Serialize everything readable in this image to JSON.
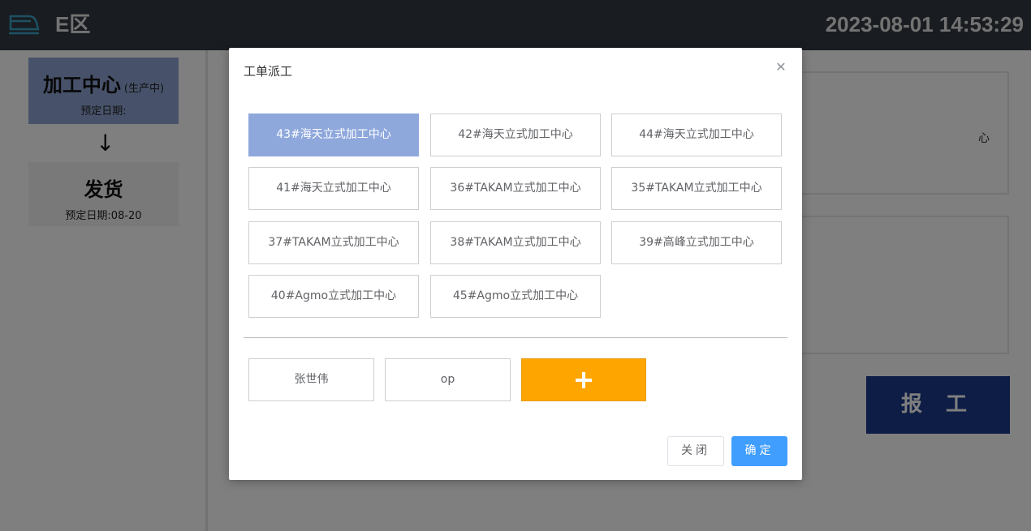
{
  "header": {
    "area_title": "E区",
    "clock": "2023-08-01 14:53:29",
    "logo_icon": "train-icon"
  },
  "sidebar": {
    "steps": [
      {
        "name": "加工中心",
        "status": "(生产中)",
        "date_label": "预定日期:"
      },
      {
        "name": "发货",
        "date_label": "预定日期:08-20"
      }
    ],
    "arrow": "↓"
  },
  "main": {
    "panel_fragment": "心",
    "report_button": "报 工"
  },
  "dialog": {
    "title": "工单派工",
    "close_icon": "close-icon",
    "machines": [
      {
        "label": "43#海天立式加工中心",
        "selected": true
      },
      {
        "label": "42#海天立式加工中心",
        "selected": false
      },
      {
        "label": "44#海天立式加工中心",
        "selected": false
      },
      {
        "label": "41#海天立式加工中心",
        "selected": false
      },
      {
        "label": "36#TAKAM立式加工中心",
        "selected": false
      },
      {
        "label": "35#TAKAM立式加工中心",
        "selected": false
      },
      {
        "label": "37#TAKAM立式加工中心",
        "selected": false
      },
      {
        "label": "38#TAKAM立式加工中心",
        "selected": false
      },
      {
        "label": "39#高峰立式加工中心",
        "selected": false
      },
      {
        "label": "40#Agmo立式加工中心",
        "selected": false
      },
      {
        "label": "45#Agmo立式加工中心",
        "selected": false
      }
    ],
    "workers": [
      "张世伟",
      "op"
    ],
    "add_icon": "plus-icon",
    "buttons": {
      "cancel": "关闭",
      "confirm": "确定"
    }
  },
  "colors": {
    "header_bg": "#333840",
    "selected_machine": "#8fa8dc",
    "add_button": "#ffa500",
    "confirm_button": "#409eff",
    "report_button": "#1c3b8a"
  }
}
